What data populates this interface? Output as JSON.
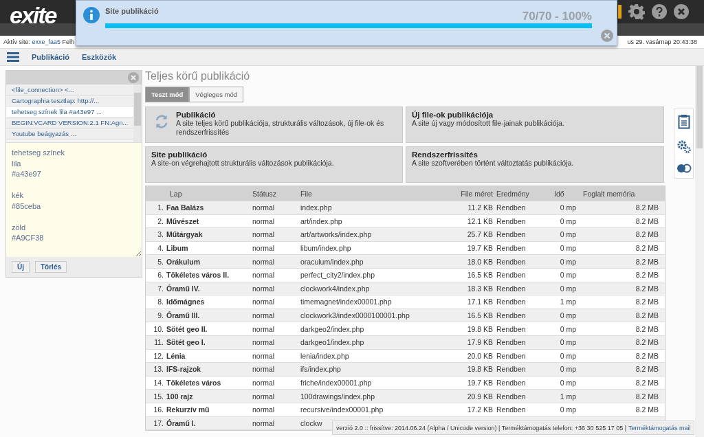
{
  "header": {
    "logo": "exite",
    "active_site_label": "Aktív site:",
    "active_site": "exxe_faa5",
    "user_fragment": "Felh",
    "datetime": "us 29. vasárnap 20:43:38"
  },
  "notification": {
    "title": "Site publikáció",
    "progress_text": "70/70 - 100%",
    "level": 1.0
  },
  "menu": [
    "Publikáció",
    "Eszközök"
  ],
  "snippets": {
    "items": [
      {
        "label": "<file_connection> <...",
        "selected": false
      },
      {
        "label": "Cartographia tesztlap: http://...",
        "selected": false
      },
      {
        "label": "tehetseg színek lila #a43e97 ...",
        "selected": true
      },
      {
        "label": "BEGIN:VCARD VERSION:2.1 FN:Agn...",
        "selected": false
      },
      {
        "label": "Youtube beágyazás ...",
        "selected": false
      }
    ],
    "text": "tehetseg színek\nlila\n#a43e97\n\nkék\n#85ceba\n\nzöld\n#A9CF38",
    "buttons": [
      "Új",
      "Törlés"
    ]
  },
  "page_title": "Teljes körű publikáció",
  "modes": [
    {
      "label": "Teszt mód",
      "selected": true
    },
    {
      "label": "Végleges mód",
      "selected": false
    }
  ],
  "actions": [
    {
      "title": "Publikáció",
      "description": "A site teljes körű publikációja, strukturális változások, új file-ok és rendszerfrissítés",
      "kind": "refresh"
    },
    {
      "title": "Új file-ok publikációja",
      "description": "A site új vagy módosított file-jainak publikációja.",
      "kind": "plain"
    },
    {
      "title": "Site publikáció",
      "description": "A site-on végrehajtott strukturális változások publikációja.",
      "kind": "plain"
    },
    {
      "title": "Rendszerfrissítés",
      "description": "A site szoftverében történt változtatás publikációja.",
      "kind": "plain"
    }
  ],
  "table": {
    "columns": [
      "Lap",
      "Státusz",
      "File",
      "File méret",
      "Eredmény",
      "Idő",
      "Foglalt memória"
    ],
    "rows": [
      {
        "num": "1.",
        "lap": "Faa Balázs",
        "status": "normal",
        "file": "index.php",
        "size": "11.2 KB",
        "result": "Rendben",
        "time": "0 mp",
        "memory": "8.2 MB"
      },
      {
        "num": "2.",
        "lap": "Művészet",
        "status": "normal",
        "file": "art/index.php",
        "size": "12.1 KB",
        "result": "Rendben",
        "time": "0 mp",
        "memory": "8.2 MB"
      },
      {
        "num": "3.",
        "lap": "Műtárgyak",
        "status": "normal",
        "file": "art/artworks/index.php",
        "size": "25.7 KB",
        "result": "Rendben",
        "time": "0 mp",
        "memory": "8.2 MB"
      },
      {
        "num": "4.",
        "lap": "Libum",
        "status": "normal",
        "file": "libum/index.php",
        "size": "19.7 KB",
        "result": "Rendben",
        "time": "0 mp",
        "memory": "8.2 MB"
      },
      {
        "num": "5.",
        "lap": "Orákulum",
        "status": "normal",
        "file": "oraculum/index.php",
        "size": "18.0 KB",
        "result": "Rendben",
        "time": "0 mp",
        "memory": "8.2 MB"
      },
      {
        "num": "6.",
        "lap": "Tökéletes város II.",
        "status": "normal",
        "file": "perfect_city2/index.php",
        "size": "16.5 KB",
        "result": "Rendben",
        "time": "0 mp",
        "memory": "8.2 MB"
      },
      {
        "num": "7.",
        "lap": "Óramű IV.",
        "status": "normal",
        "file": "clockwork4/index.php",
        "size": "18.3 KB",
        "result": "Rendben",
        "time": "0 mp",
        "memory": "8.2 MB"
      },
      {
        "num": "8.",
        "lap": "Időmágnes",
        "status": "normal",
        "file": "timemagnet/index00001.php",
        "size": "17.1 KB",
        "result": "Rendben",
        "time": "1 mp",
        "memory": "8.2 MB"
      },
      {
        "num": "9.",
        "lap": "Óramű III.",
        "status": "normal",
        "file": "clockwork3/index0000100001.php",
        "size": "16.5 KB",
        "result": "Rendben",
        "time": "0 mp",
        "memory": "8.2 MB"
      },
      {
        "num": "10.",
        "lap": "Sötét geo II.",
        "status": "normal",
        "file": "darkgeo2/index.php",
        "size": "19.8 KB",
        "result": "Rendben",
        "time": "0 mp",
        "memory": "8.2 MB"
      },
      {
        "num": "11.",
        "lap": "Sötét geo I.",
        "status": "normal",
        "file": "darkgeo1/index.php",
        "size": "17.9 KB",
        "result": "Rendben",
        "time": "0 mp",
        "memory": "8.2 MB"
      },
      {
        "num": "12.",
        "lap": "Lénia",
        "status": "normal",
        "file": "lenia/index.php",
        "size": "20.0 KB",
        "result": "Rendben",
        "time": "0 mp",
        "memory": "8.2 MB"
      },
      {
        "num": "13.",
        "lap": "IFS-rajzok",
        "status": "normal",
        "file": "ifs/index.php",
        "size": "19.8 KB",
        "result": "Rendben",
        "time": "0 mp",
        "memory": "8.2 MB"
      },
      {
        "num": "14.",
        "lap": "Tökéletes város",
        "status": "normal",
        "file": "friche/index00001.php",
        "size": "19.7 KB",
        "result": "Rendben",
        "time": "0 mp",
        "memory": "8.2 MB"
      },
      {
        "num": "15.",
        "lap": "100 rajz",
        "status": "normal",
        "file": "100drawings/index.php",
        "size": "20.9 KB",
        "result": "Rendben",
        "time": "1 mp",
        "memory": "8.2 MB"
      },
      {
        "num": "16.",
        "lap": "Rekurzív mű",
        "status": "normal",
        "file": "recursive/index00001.php",
        "size": "17.2 KB",
        "result": "Rendben",
        "time": "0 mp",
        "memory": "8.2 MB"
      },
      {
        "num": "17.",
        "lap": "Óramű I.",
        "status": "normal",
        "file": "clockw"
      }
    ]
  },
  "footer": {
    "text": "verzió 2.0 :: frissítve: 2014.06.24 (Alpha / Unicode version) | Terméktámogatás telefon: +36 30 525 17 05 |",
    "link": "Terméktámogatás mail"
  }
}
